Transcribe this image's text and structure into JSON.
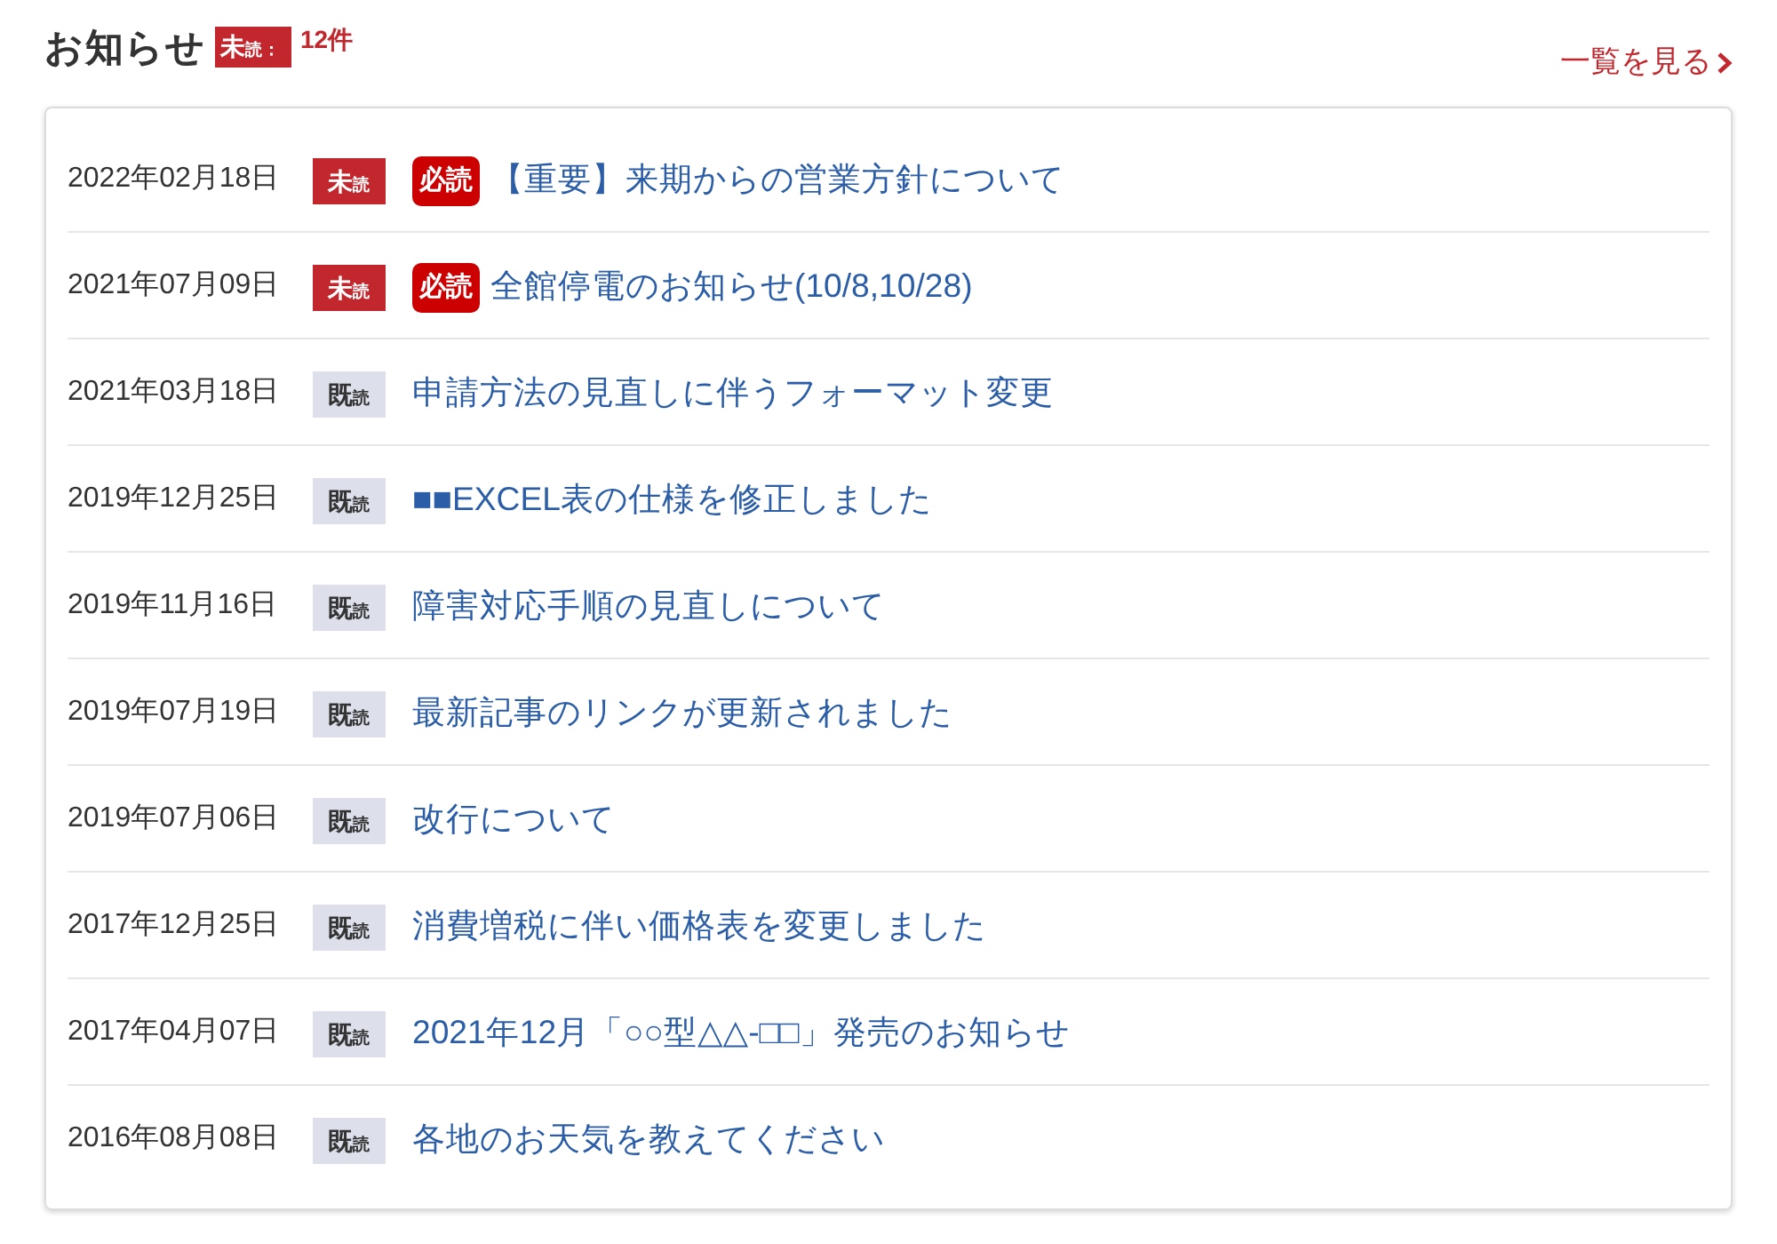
{
  "header": {
    "title": "お知らせ",
    "unread_badge": "未$_{読：}$",
    "unread_count": "12件",
    "view_all": "一覧を見る"
  },
  "notices": [
    {
      "date": "2022年02月18日",
      "read": false,
      "status_label": "未$_{読}$",
      "required_label": "必読",
      "title": "【重要】来期からの営業方針について"
    },
    {
      "date": "2021年07月09日",
      "read": false,
      "status_label": "未$_{読}$",
      "required_label": "必読",
      "title": "全館停電のお知らせ(10/8,10/28)"
    },
    {
      "date": "2021年03月18日",
      "read": true,
      "status_label": "既$_{読}$",
      "title": "申請方法の見直しに伴うフォーマット変更"
    },
    {
      "date": "2019年12月25日",
      "read": true,
      "status_label": "既$_{読}$",
      "title": "■■EXCEL表の仕様を修正しました"
    },
    {
      "date": "2019年11月16日",
      "read": true,
      "status_label": "既$_{読}$",
      "title": "障害対応手順の見直しについて"
    },
    {
      "date": "2019年07月19日",
      "read": true,
      "status_label": "既$_{読}$",
      "title": "最新記事のリンクが更新されました"
    },
    {
      "date": "2019年07月06日",
      "read": true,
      "status_label": "既$_{読}$",
      "title": "改行について"
    },
    {
      "date": "2017年12月25日",
      "read": true,
      "status_label": "既$_{読}$",
      "title": "消費増税に伴い価格表を変更しました"
    },
    {
      "date": "2017年04月07日",
      "read": true,
      "status_label": "既$_{読}$",
      "title": "2021年12月「○○型△△-□□」発売のお知らせ"
    },
    {
      "date": "2016年08月08日",
      "read": true,
      "status_label": "既$_{読}$",
      "title": "各地のお天気を教えてください"
    }
  ]
}
